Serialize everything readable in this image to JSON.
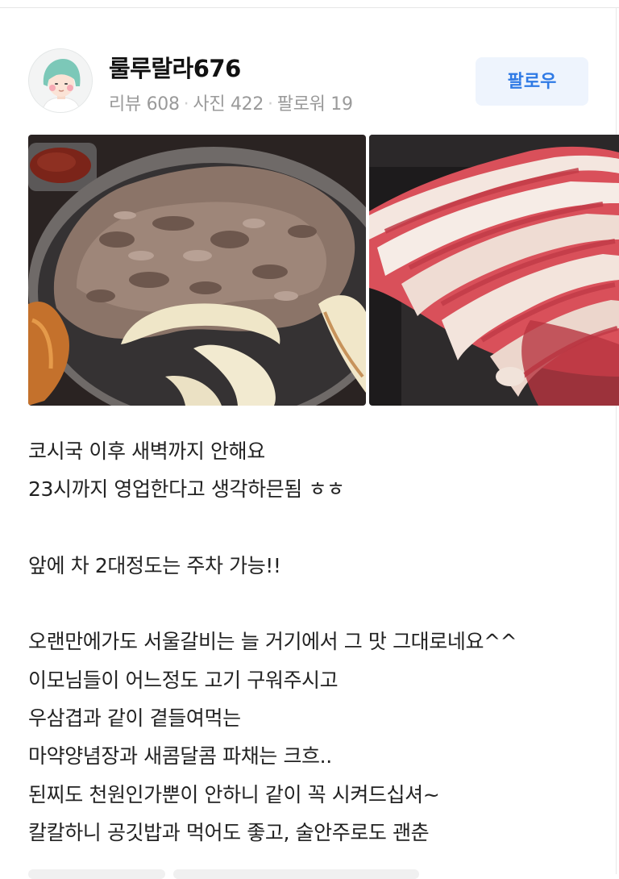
{
  "reviewer": {
    "name": "룰루랄라676",
    "reviews": "리뷰 608",
    "photos": "사진 422",
    "followers": "팔로워 19"
  },
  "follow_button": {
    "label": "팔로우"
  },
  "review": {
    "lines": [
      "코시국 이후 새벽까지 안해요",
      "23시까지 영업한다고 생각하믄됨 ㅎㅎ",
      "",
      "앞에 차 2대정도는 주차 가능!!",
      "",
      "오랜만에가도 서울갈비는 늘 거기에서 그 맛 그대로네요^^",
      "이모님들이 어느정도 고기 구워주시고",
      "우삼겹과 같이 곁들여먹는",
      "마약양념장과 새콤달콤 파채는 크흐..",
      "된찌도 천원인가뿐이 안하니 같이 꼭 시켜드십셔~",
      "칼칼하니 공깃밥과 먹어도 좋고, 술안주로도 괜춘"
    ]
  },
  "icons": {
    "avatar": "avatar-illustration",
    "photo_1": "bulgogi-grill-photo",
    "photo_2": "raw-brisket-photo"
  },
  "colors": {
    "accent": "#2f7ae5",
    "button_bg": "#eef4fd",
    "muted_text": "#9a9a9a"
  }
}
